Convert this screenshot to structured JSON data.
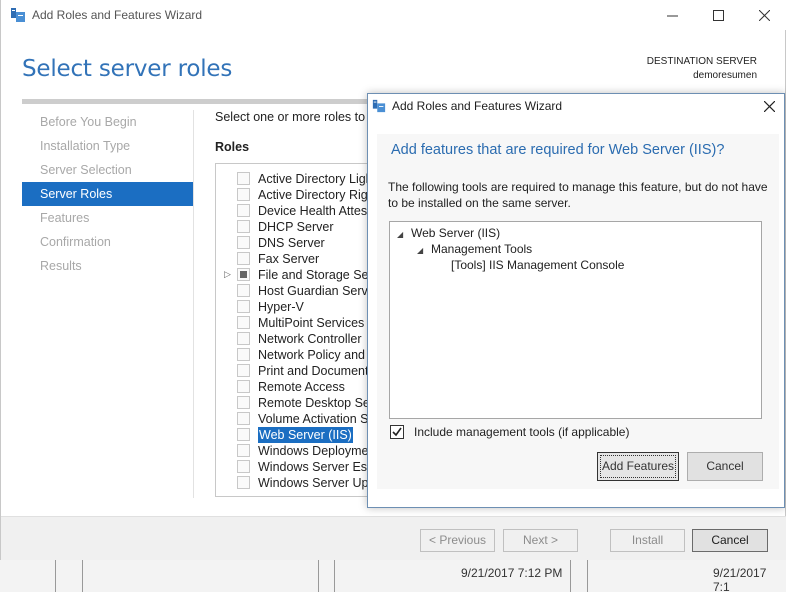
{
  "window": {
    "title": "Add Roles and Features Wizard",
    "controls": {
      "minimize": "—",
      "maximize": "☐",
      "close": "✕"
    }
  },
  "header": {
    "title": "Select server roles",
    "destination_label": "DESTINATION SERVER",
    "destination_server": "demoresumen"
  },
  "nav": {
    "items": [
      {
        "label": "Before You Begin",
        "active": false
      },
      {
        "label": "Installation Type",
        "active": false
      },
      {
        "label": "Server Selection",
        "active": false
      },
      {
        "label": "Server Roles",
        "active": true
      },
      {
        "label": "Features",
        "active": false
      },
      {
        "label": "Confirmation",
        "active": false
      },
      {
        "label": "Results",
        "active": false
      }
    ]
  },
  "content": {
    "description": "Select one or more roles to install on the selected server.",
    "roles_heading": "Roles",
    "roles": [
      {
        "label": "Active Directory Lightweight Directory Services",
        "state": "unchecked"
      },
      {
        "label": "Active Directory Rights Management Services",
        "state": "unchecked"
      },
      {
        "label": "Device Health Attestation",
        "state": "unchecked"
      },
      {
        "label": "DHCP Server",
        "state": "unchecked"
      },
      {
        "label": "DNS Server",
        "state": "unchecked"
      },
      {
        "label": "Fax Server",
        "state": "unchecked"
      },
      {
        "label": "File and Storage Services",
        "state": "partial",
        "expandable": true
      },
      {
        "label": "Host Guardian Service",
        "state": "unchecked"
      },
      {
        "label": "Hyper-V",
        "state": "unchecked"
      },
      {
        "label": "MultiPoint Services",
        "state": "unchecked"
      },
      {
        "label": "Network Controller",
        "state": "unchecked"
      },
      {
        "label": "Network Policy and Access Services",
        "state": "unchecked"
      },
      {
        "label": "Print and Document Services",
        "state": "unchecked"
      },
      {
        "label": "Remote Access",
        "state": "unchecked"
      },
      {
        "label": "Remote Desktop Services",
        "state": "unchecked"
      },
      {
        "label": "Volume Activation Services",
        "state": "unchecked"
      },
      {
        "label": "Web Server (IIS)",
        "state": "unchecked",
        "selected": true
      },
      {
        "label": "Windows Deployment Services",
        "state": "unchecked"
      },
      {
        "label": "Windows Server Essentials Experience",
        "state": "unchecked"
      },
      {
        "label": "Windows Server Update Services",
        "state": "unchecked"
      }
    ]
  },
  "footer": {
    "previous": "< Previous",
    "next": "Next >",
    "install": "Install",
    "cancel": "Cancel"
  },
  "dialog": {
    "title": "Add Roles and Features Wizard",
    "close": "✕",
    "heading": "Add features that are required for Web Server (IIS)?",
    "text": "The following tools are required to manage this feature, but do not have to be installed on the same server.",
    "tree": [
      {
        "label": "Web Server (IIS)",
        "level": 0,
        "expander": "◢"
      },
      {
        "label": "Management Tools",
        "level": 1,
        "expander": "◢"
      },
      {
        "label": "[Tools] IIS Management Console",
        "level": 2,
        "expander": ""
      }
    ],
    "include_checked": true,
    "include_label": "Include management tools (if applicable)",
    "add_features": "Add Features",
    "cancel": "Cancel"
  },
  "taskbar": {
    "time1": "9/21/2017 7:12 PM",
    "time2": "9/21/2017 7:1"
  },
  "colors": {
    "accent": "#1b6ec2",
    "heading": "#3273b8"
  }
}
